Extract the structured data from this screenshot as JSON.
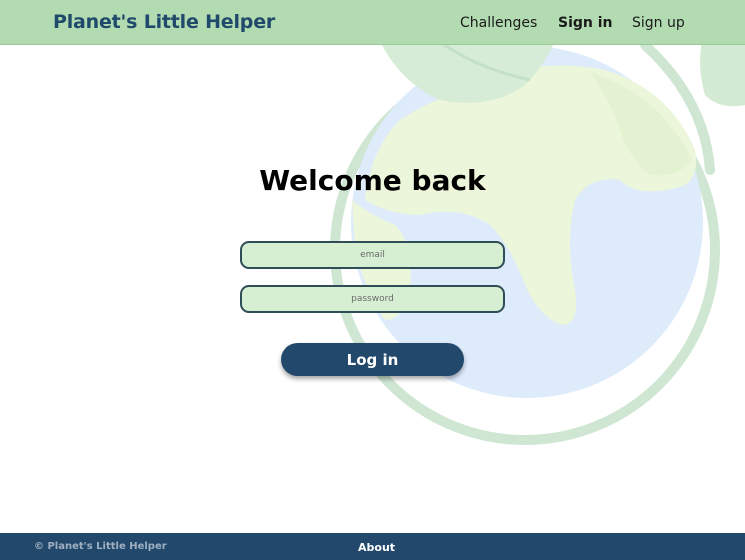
{
  "header": {
    "brand": "Planet's Little Helper",
    "nav": {
      "challenges": "Challenges",
      "sign_in": "Sign in",
      "sign_up": "Sign up"
    }
  },
  "login": {
    "title": "Welcome back",
    "email_placeholder": "email",
    "password_placeholder": "password",
    "submit_label": "Log in"
  },
  "footer": {
    "copyright": "© Planet's Little Helper",
    "about": "About"
  },
  "colors": {
    "header_bg": "#b3dbb1",
    "brand": "#1f4a6b",
    "primary": "#22496b",
    "field_bg": "#d6efd3"
  },
  "background": {
    "illustration": "globe-with-leaves"
  }
}
